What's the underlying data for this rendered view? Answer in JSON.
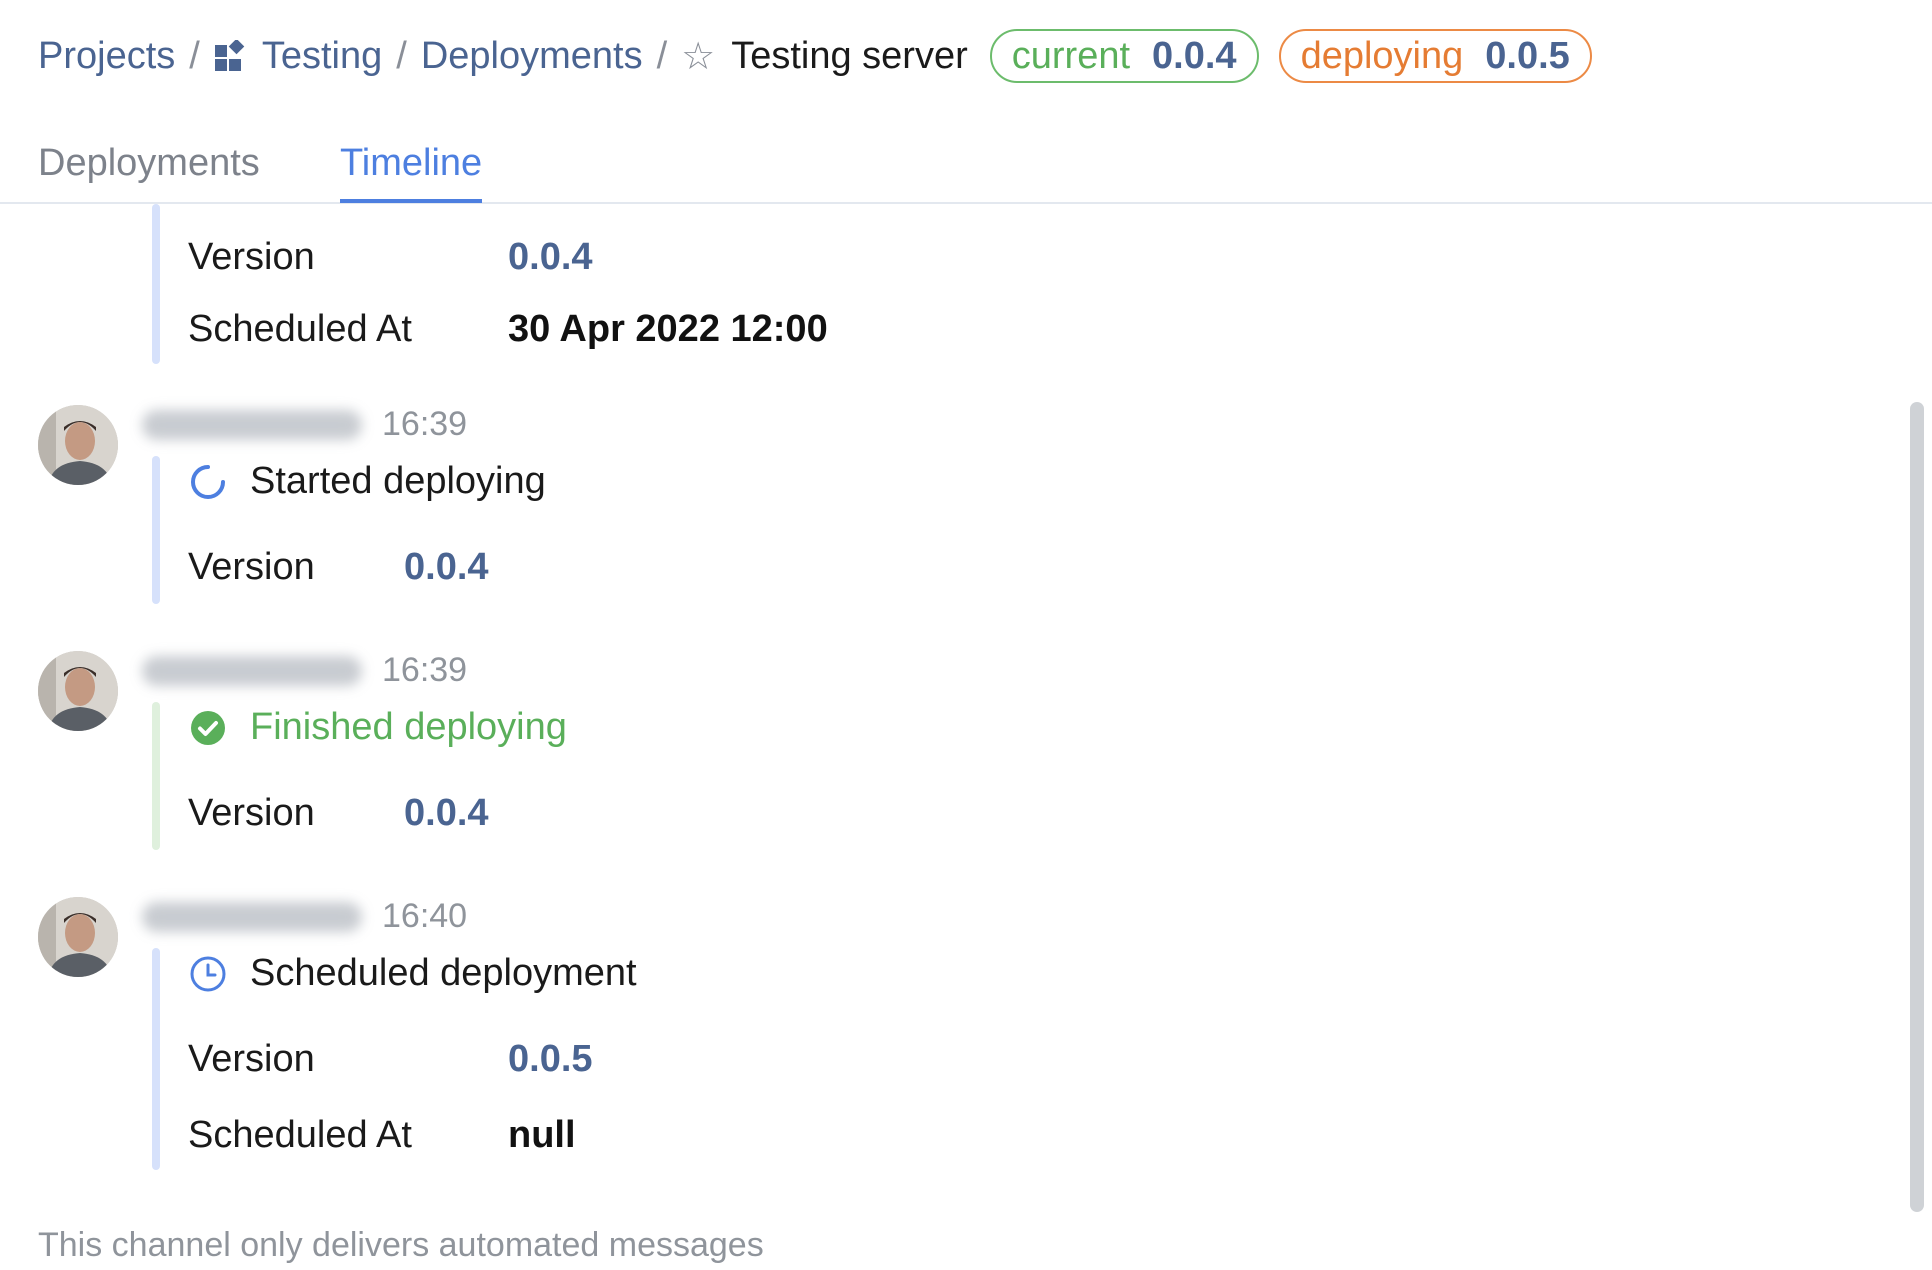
{
  "breadcrumb": {
    "projects": "Projects",
    "separator": "/",
    "project": "Testing",
    "project_icon": "project-grid-icon",
    "deployments": "Deployments",
    "star_icon": "star-outline-icon",
    "current": "Testing server"
  },
  "badges": {
    "current": {
      "label": "current",
      "version": "0.0.4",
      "color": "#5aaf5a"
    },
    "deploying": {
      "label": "deploying",
      "version": "0.0.5",
      "color": "#e57c33"
    }
  },
  "tabs": [
    {
      "label": "Deployments",
      "active": false
    },
    {
      "label": "Timeline",
      "active": true
    }
  ],
  "timeline": {
    "partial_event": {
      "version_label": "Version",
      "version": "0.0.4",
      "scheduled_label": "Scheduled At",
      "scheduled": "30 Apr 2022 12:00"
    },
    "events": [
      {
        "time": "16:39",
        "icon": "spinner-icon",
        "title": "Started deploying",
        "version_label": "Version",
        "version": "0.0.4"
      },
      {
        "time": "16:39",
        "icon": "check-circle-icon",
        "title": "Finished deploying",
        "version_label": "Version",
        "version": "0.0.4"
      },
      {
        "time": "16:40",
        "icon": "clock-icon",
        "title": "Scheduled deployment",
        "version_label": "Version",
        "version": "0.0.5",
        "scheduled_label": "Scheduled At",
        "scheduled": "null"
      }
    ]
  },
  "footer": "This channel only delivers automated messages",
  "colors": {
    "link": "#4a6491",
    "accent": "#4d7fe0",
    "success": "#5aaf5a",
    "warning": "#e57c33"
  }
}
